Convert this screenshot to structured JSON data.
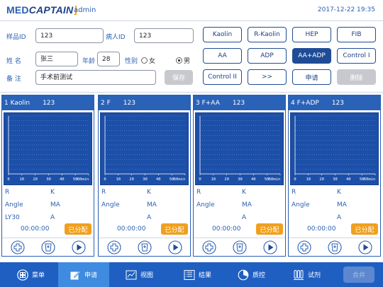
{
  "header": {
    "logo_part1": "MED",
    "logo_part2": "CAPTAIN",
    "logo_bracket": "⌋",
    "user": "admin",
    "datetime": "2017-12-22 19:35"
  },
  "form": {
    "sample_id_label": "样品ID",
    "sample_id_value": "123",
    "patient_id_label": "病人ID",
    "patient_id_value": "123",
    "name_label": "姓 名",
    "name_value": "张三",
    "age_label": "年龄",
    "age_value": "28",
    "gender_label": "性别",
    "gender_female": "女",
    "gender_male": "男",
    "gender_selected": "男",
    "remark_label": "备 注",
    "remark_value": "手术前测试",
    "save_label": "保存"
  },
  "reagents": [
    {
      "label": "Kaolin",
      "state": "normal"
    },
    {
      "label": "R-Kaolin",
      "state": "normal"
    },
    {
      "label": "HEP",
      "state": "normal"
    },
    {
      "label": "FIB",
      "state": "normal"
    },
    {
      "label": "AA",
      "state": "normal"
    },
    {
      "label": "ADP",
      "state": "normal"
    },
    {
      "label": "AA+ADP",
      "state": "selected"
    },
    {
      "label": "Control I",
      "state": "normal"
    },
    {
      "label": "Control II",
      "state": "normal"
    },
    {
      "label": ">>",
      "state": "normal"
    },
    {
      "label": "申请",
      "state": "normal"
    },
    {
      "label": "删除",
      "state": "disabled"
    }
  ],
  "channels": [
    {
      "title": "1 Kaolin",
      "sample": "123",
      "r": "R",
      "k": "K",
      "angle": "Angle",
      "ma": "MA",
      "ly30": "LY30",
      "a": "A",
      "time": "00:00:00",
      "assign": "已分配"
    },
    {
      "title": "2 F",
      "sample": "123",
      "r": "R",
      "k": "K",
      "angle": "Angle",
      "ma": "MA",
      "ly30": "",
      "a": "A",
      "time": "00:00:00",
      "assign": "已分配"
    },
    {
      "title": "3 F+AA",
      "sample": "123",
      "r": "R",
      "k": "K",
      "angle": "Angle",
      "ma": "MA",
      "ly30": "",
      "a": "A",
      "time": "00:00:00",
      "assign": "已分配"
    },
    {
      "title": "4 F+ADP",
      "sample": "123",
      "r": "R",
      "k": "K",
      "angle": "Angle",
      "ma": "MA",
      "ly30": "",
      "a": "A",
      "time": "00:00:00",
      "assign": "已分配"
    }
  ],
  "graph_axis": {
    "ticks": [
      "0",
      "10",
      "20",
      "30",
      "40",
      "50",
      "60min"
    ]
  },
  "nav": [
    {
      "label": "菜单",
      "icon": "menu-grid-icon"
    },
    {
      "label": "申请",
      "icon": "edit-icon"
    },
    {
      "label": "视图",
      "icon": "chart-view-icon"
    },
    {
      "label": "结果",
      "icon": "results-list-icon"
    },
    {
      "label": "质控",
      "icon": "qc-pie-icon"
    },
    {
      "label": "试剂",
      "icon": "reagent-tubes-icon"
    }
  ],
  "nav_active": "申请",
  "merge_label": "合并",
  "colors": {
    "primary": "#1f5fc2",
    "accent_orange": "#f0a01e",
    "graph_bg": "#1c4fa8"
  }
}
